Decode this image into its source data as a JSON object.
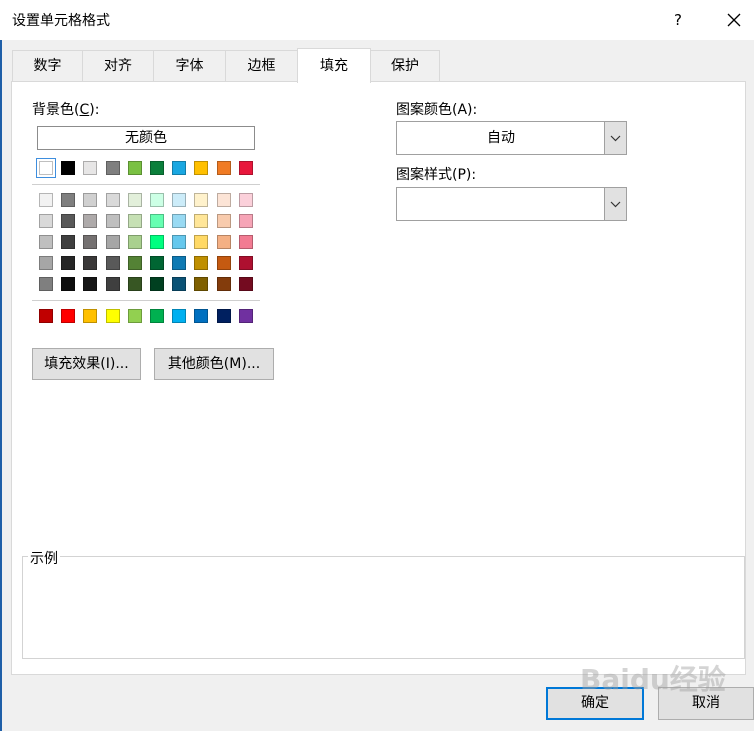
{
  "dialog": {
    "title": "设置单元格格式",
    "help": "?"
  },
  "tabs": [
    {
      "label": "数字"
    },
    {
      "label": "对齐"
    },
    {
      "label": "字体"
    },
    {
      "label": "边框"
    },
    {
      "label": "填充",
      "active": true
    },
    {
      "label": "保护"
    }
  ],
  "fill": {
    "background_label_prefix": "背景色(",
    "background_label_key": "C",
    "background_label_suffix": "):",
    "no_color": "无颜色",
    "selected_swatch": "#ffffff",
    "theme_row": [
      "#ffffff",
      "#000000",
      "#e7e6e6",
      "#7f7f7f",
      "#7ac143",
      "#0b7f3b",
      "#1aa7e1",
      "#ffc000",
      "#f07b24",
      "#e8173c"
    ],
    "shade_rows": [
      [
        "#f2f2f2",
        "#7f7f7f",
        "#d0d0d0",
        "#d9d9d9",
        "#e2efda",
        "#ccffe5",
        "#ccecf9",
        "#fff2cc",
        "#fce4d6",
        "#fbd0da"
      ],
      [
        "#d9d9d9",
        "#595959",
        "#aeaaaa",
        "#bfbfbf",
        "#c6e0b4",
        "#66ffb2",
        "#99daf3",
        "#ffe699",
        "#f8cbad",
        "#f6a4b6"
      ],
      [
        "#bfbfbf",
        "#3f3f3f",
        "#757171",
        "#a6a6a6",
        "#a9d08e",
        "#00ff80",
        "#66c8ed",
        "#ffd966",
        "#f4b084",
        "#f27b92"
      ],
      [
        "#a6a6a6",
        "#262626",
        "#3a3838",
        "#595959",
        "#548235",
        "#006633",
        "#0f7ab3",
        "#bf8f00",
        "#c55a11",
        "#ae1030"
      ],
      [
        "#7f7f7f",
        "#0d0d0d",
        "#161616",
        "#3f3f3f",
        "#375623",
        "#004020",
        "#0a5275",
        "#7f6000",
        "#833c0c",
        "#740b20"
      ]
    ],
    "standard_row": [
      "#c00000",
      "#ff0000",
      "#ffc000",
      "#ffff00",
      "#92d050",
      "#00b050",
      "#00b0f0",
      "#0070c0",
      "#002060",
      "#7030a0"
    ],
    "fill_effects_button": "填充效果(I)...",
    "more_colors_button": "其他颜色(M)...",
    "pattern_color_label": "图案颜色(A):",
    "pattern_color_value": "自动",
    "pattern_style_label": "图案样式(P):",
    "pattern_style_value": "",
    "sample_label": "示例"
  },
  "footer": {
    "ok": "确定",
    "cancel": "取消"
  },
  "watermark": "Baidu经验"
}
